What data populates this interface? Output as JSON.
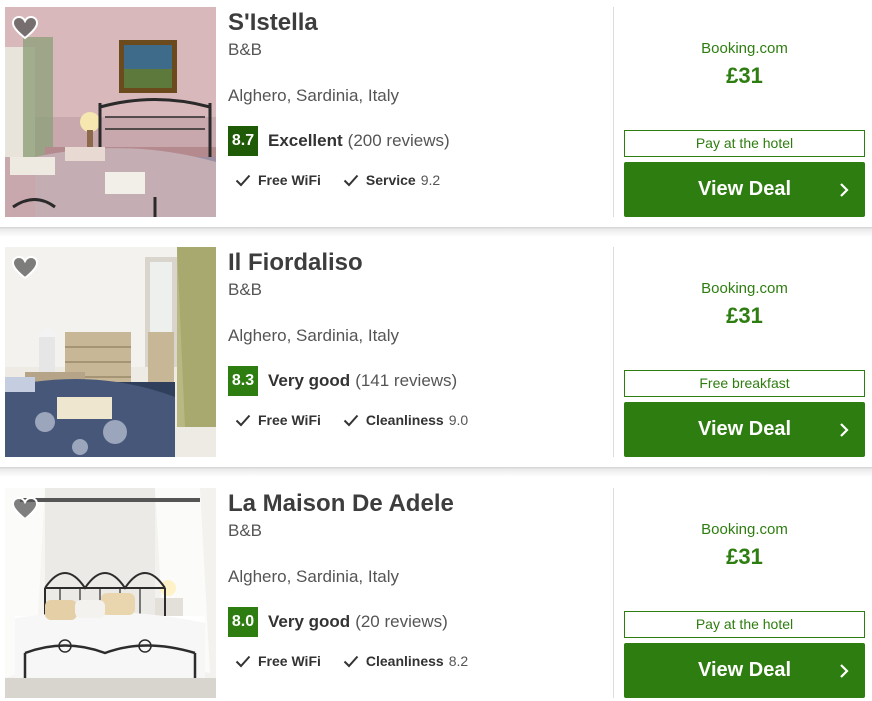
{
  "listings": [
    {
      "name": "S'Istella",
      "type": "B&B",
      "location": "Alghero, Sardinia, Italy",
      "score": "8.7",
      "rating_label": "Excellent",
      "reviews": "(200 reviews)",
      "amenity_1": "Free WiFi",
      "amenity_2_label": "Service",
      "amenity_2_value": "9.2",
      "provider": "Booking.com",
      "price": "£31",
      "tag": "Pay at the hotel",
      "button": "View Deal"
    },
    {
      "name": "Il Fiordaliso",
      "type": "B&B",
      "location": "Alghero, Sardinia, Italy",
      "score": "8.3",
      "rating_label": "Very good",
      "reviews": "(141 reviews)",
      "amenity_1": "Free WiFi",
      "amenity_2_label": "Cleanliness",
      "amenity_2_value": "9.0",
      "provider": "Booking.com",
      "price": "£31",
      "tag": "Free breakfast",
      "button": "View Deal"
    },
    {
      "name": "La Maison De Adele",
      "type": "B&B",
      "location": "Alghero, Sardinia, Italy",
      "score": "8.0",
      "rating_label": "Very good",
      "reviews": "(20 reviews)",
      "amenity_1": "Free WiFi",
      "amenity_2_label": "Cleanliness",
      "amenity_2_value": "8.2",
      "provider": "Booking.com",
      "price": "£31",
      "tag": "Pay at the hotel",
      "button": "View Deal"
    }
  ],
  "colors": {
    "accent_green": "#2e7d10",
    "score_dark_green": "#1f5a06"
  },
  "icons": {
    "favorite": "heart-icon",
    "amenity": "check-icon",
    "button": "chevron-right-icon"
  }
}
